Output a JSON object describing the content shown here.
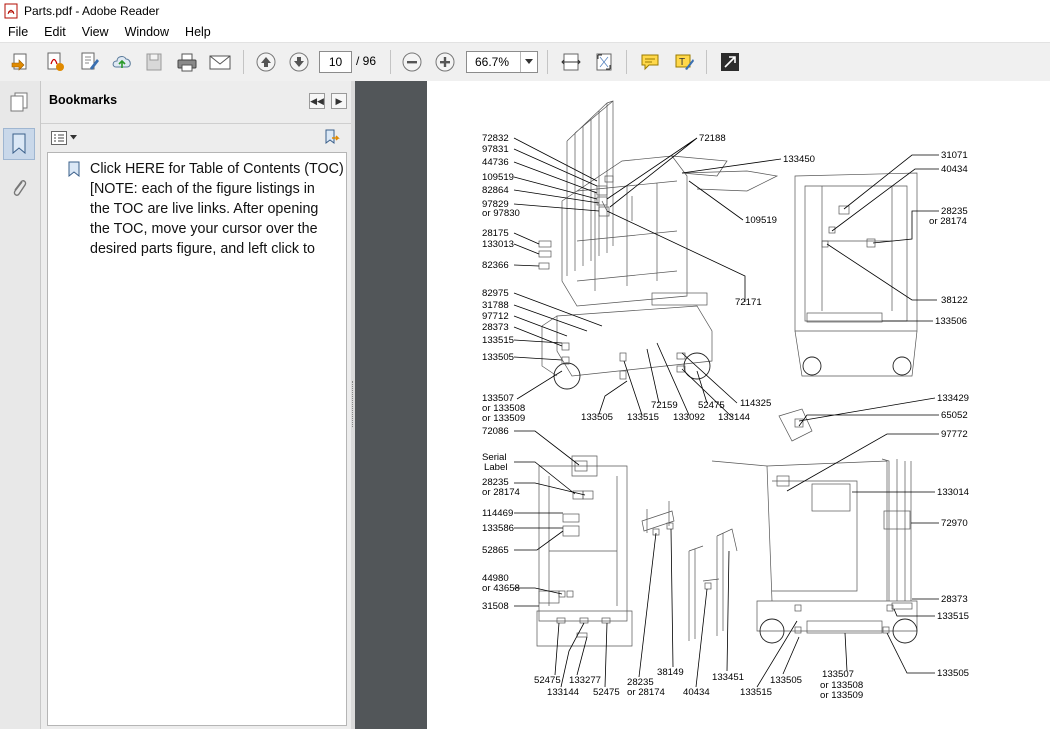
{
  "window": {
    "title": "Parts.pdf - Adobe Reader"
  },
  "menu": [
    "File",
    "Edit",
    "View",
    "Window",
    "Help"
  ],
  "toolbar": {
    "page_current": "10",
    "page_total": "/ 96",
    "zoom": "66.7%"
  },
  "bookmarks": {
    "header": "Bookmarks",
    "item_lines": [
      "Click HERE for Table of Contents (TOC)",
      "[NOTE: each of the figure listings in",
      "the TOC are live links. After opening",
      "the TOC, move your cursor over the",
      "desired parts figure, and left click to"
    ]
  },
  "diagram": {
    "top_left_labels": [
      "72832",
      "97831",
      "44736",
      "109519",
      "82864",
      "97829",
      "or 97830",
      "28175",
      "133013",
      "82366",
      "82975",
      "31788",
      "97712",
      "28373",
      "133515",
      "133505",
      "133507",
      "or 133508",
      "or 133509"
    ],
    "top_center_labels": [
      "72188",
      "133450",
      "109519",
      "72171",
      "114325",
      "52475",
      "133144",
      "72159",
      "133515",
      "133092",
      "133505"
    ],
    "top_right_labels": [
      "31071",
      "40434",
      "28235",
      "or 28174",
      "38122",
      "133506"
    ],
    "bottom_left_labels": [
      "72086",
      "Serial",
      "Label",
      "28235",
      "or 28174",
      "114469",
      "133586",
      "52865",
      "44980",
      "or 43658",
      "31508",
      "52475",
      "133144",
      "133277",
      "52475"
    ],
    "bottom_center_labels": [
      "28235",
      "or 28174",
      "38149",
      "40434",
      "133451",
      "133515",
      "133505"
    ],
    "bottom_right_labels": [
      "133429",
      "65052",
      "97772",
      "133014",
      "72970",
      "28373",
      "133515",
      "133507",
      "or 133508",
      "or 133509",
      "133505"
    ]
  }
}
